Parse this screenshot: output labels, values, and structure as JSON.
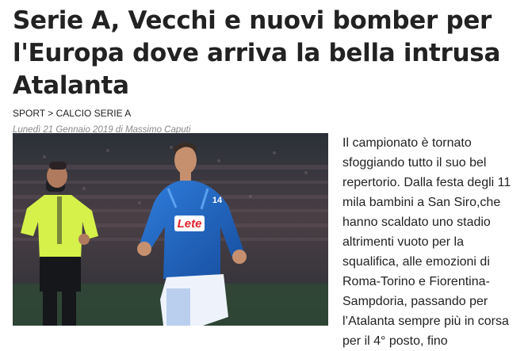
{
  "article": {
    "title": "Serie A, Vecchi e nuovi bomber per l'Europa dove arriva la bella intrusa Atalanta",
    "breadcrumb": {
      "section": "SPORT",
      "separator": ">",
      "subsection": "CALCIO SERIE A"
    },
    "byline": "Lunedì 21 Gennaio 2019 di Massimo Caputi",
    "image": {
      "sponsor_text": "Lete",
      "player_number": "14",
      "alt": "photo"
    },
    "body": "Il campionato è tornato sfoggiando tutto il suo bel repertorio. Dalla festa degli 11 mila bambini a San Siro,che hanno scaldato uno stadio altrimenti vuoto per la squalifica, alle emozioni di Roma-Torino e Fiorentina- Sampdoria, passando per l’Atalanta sempre più in corsa per il 4° posto, fino"
  },
  "colors": {
    "napoli_blue": "#1f64c6",
    "referee_yellow": "#d5f14a",
    "sponsor_red": "#e2232a"
  }
}
